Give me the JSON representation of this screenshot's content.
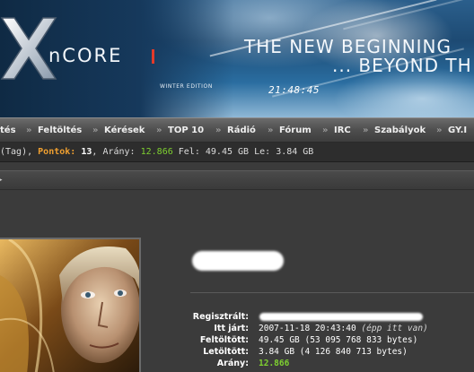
{
  "header": {
    "logo_text": "nCORE",
    "edition": "WINTER EDITION",
    "headline_line1": "THE NEW BEGINNING",
    "headline_line2": "... BEYOND TH",
    "clock": "21:48:45",
    "colors": {
      "accent_red": "#e23a2a",
      "banner_blue": "#2b5f8c"
    }
  },
  "nav": {
    "items": [
      {
        "label": "tés",
        "icon": "separator-arrow"
      },
      {
        "label": "Feltöltés"
      },
      {
        "label": "Kérések"
      },
      {
        "label": "TOP 10"
      },
      {
        "label": "Rádió"
      },
      {
        "label": "Fórum"
      },
      {
        "label": "IRC"
      },
      {
        "label": "Szabályok"
      },
      {
        "label": "GY.I"
      }
    ],
    "separator": "»"
  },
  "status": {
    "rank": "(Tag),",
    "points_label": "Pontok:",
    "points_value": "13",
    "ratio_label": "Arány:",
    "ratio_value": "12.866",
    "upload_label": "Fel:",
    "upload_value": "49.45 GB",
    "download_label": "Le:",
    "download_value": "3.84 GB",
    "colors": {
      "points": "#f0a030",
      "ratio": "#7ed030"
    }
  },
  "profile": {
    "fields": [
      {
        "label": "Regisztrált:",
        "value": "",
        "redacted": true
      },
      {
        "label": "Itt járt:",
        "value": "2007-11-18 20:43:40",
        "note": "(épp itt van)"
      },
      {
        "label": "Feltöltött:",
        "value": "49.45 GB (53 095 768 833 bytes)"
      },
      {
        "label": "Letöltött:",
        "value": "3.84 GB (4 126 840 713 bytes)"
      },
      {
        "label": "Arány:",
        "value": "12.866",
        "highlight": "#7ed030"
      }
    ]
  }
}
